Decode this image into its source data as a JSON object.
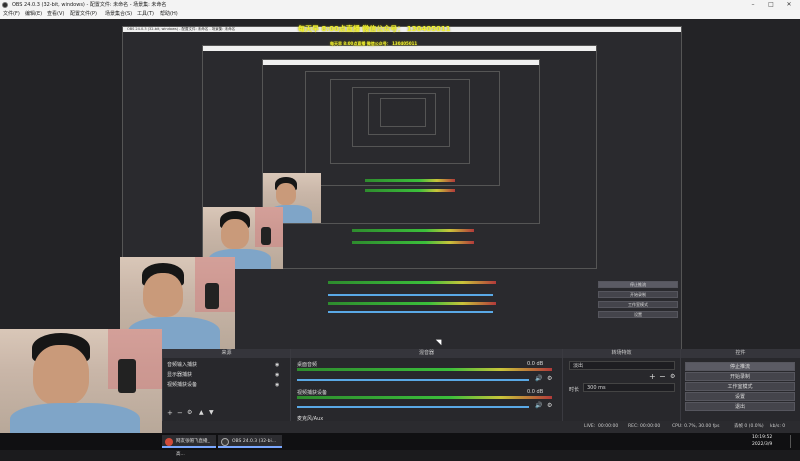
{
  "window": {
    "title": "OBS 24.0.3 (32-bit, windows) - 配置文件: 未命名 - 场景集: 未命名",
    "controls": [
      "minimize-icon",
      "maximize-icon",
      "close-icon"
    ]
  },
  "menu": [
    "文件(F)",
    "编辑(E)",
    "查看(V)",
    "配置文件(P)",
    "场景集合(S)",
    "工具(T)",
    "帮助(H)"
  ],
  "overlay": {
    "line1": "每天早 8:00点直播 微信公众号： 130405011"
  },
  "nested": {
    "window_title": "OBS 24.0.3 (32-bit, windows) - 配置文件: 未命名 - 场景集: 未命名",
    "toolbar_labels": [
      "来源",
      "混音器",
      "转场特效",
      "控件"
    ]
  },
  "panels": {
    "sources": {
      "header": "来源",
      "items": [
        "音频输入捕获",
        "显示器捕获",
        "视频捕获设备"
      ],
      "controls": [
        "add-icon",
        "remove-icon",
        "gear-icon",
        "up-icon",
        "down-icon"
      ]
    },
    "mixer": {
      "header": "混音器",
      "channels": [
        {
          "name": "桌面音频",
          "db": "0.0 dB"
        },
        {
          "name": "视频捕获设备",
          "db": "0.0 dB"
        },
        {
          "name": "麦克风/Aux",
          "db": ""
        }
      ]
    },
    "transitions": {
      "header": "转场特效",
      "type": "淡出",
      "duration_label": "时长",
      "duration_value": "300 ms"
    },
    "controls": {
      "header": "控件",
      "buttons": [
        "停止推流",
        "开始录制",
        "工作室模式",
        "设置",
        "退出"
      ],
      "active": "停止推流"
    }
  },
  "status": {
    "live_label": "LIVE:",
    "live_time": "00:00:00",
    "rec_label": "REC:",
    "rec_time": "00:00:00",
    "cpu": "CPU: 0.7%, 30.00 fps",
    "dropped": "丢帧 0 (0.0%)",
    "kb": "kb/s: 0"
  },
  "taskbar": {
    "items": [
      {
        "label": "网友张帽飞直播_高...",
        "color": "#d14b3a"
      },
      {
        "label": "OBS 24.0.3 (32-bi...",
        "color": "#3a3a3a"
      }
    ],
    "time": "10:19:52",
    "date": "2022/3/9"
  }
}
